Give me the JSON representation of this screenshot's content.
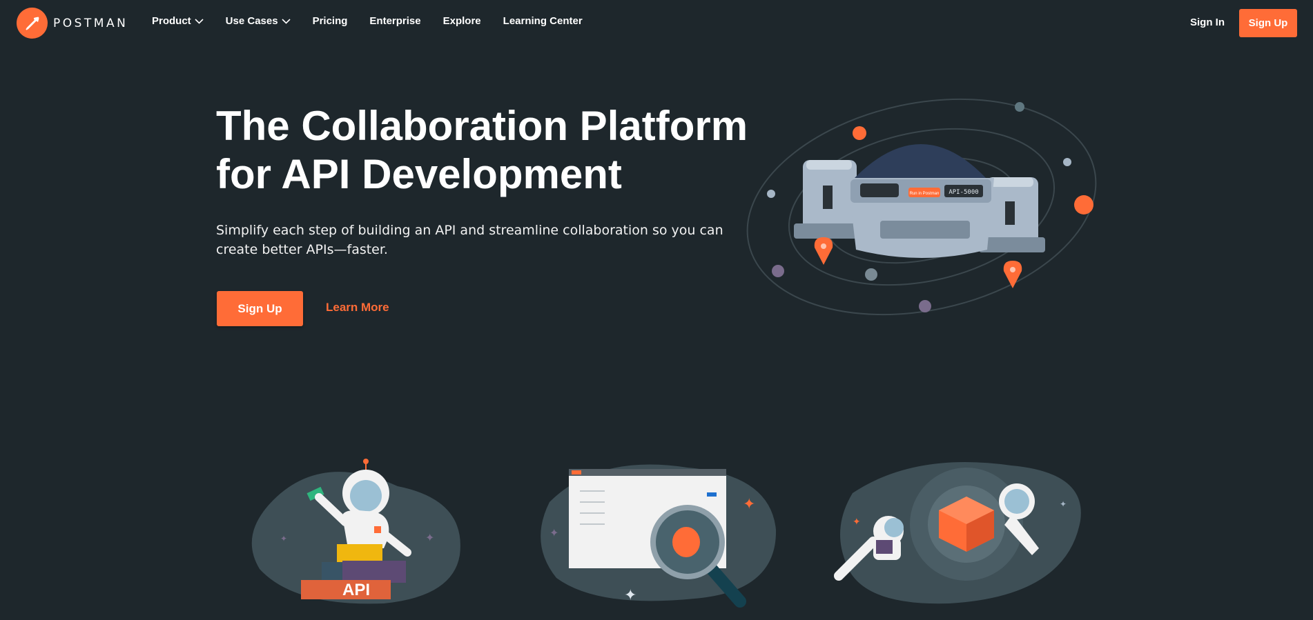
{
  "brand": {
    "name": "POSTMAN",
    "accent": "#ff6c37",
    "background": "#1e272c"
  },
  "nav": {
    "items": [
      {
        "label": "Product",
        "has_dropdown": true
      },
      {
        "label": "Use Cases",
        "has_dropdown": true
      },
      {
        "label": "Pricing"
      },
      {
        "label": "Enterprise"
      },
      {
        "label": "Explore"
      },
      {
        "label": "Learning Center"
      }
    ],
    "sign_in": "Sign In",
    "sign_up": "Sign Up"
  },
  "hero": {
    "title_line1": "The Collaboration Platform",
    "title_line2": "for API Development",
    "subtitle_line1": "Simplify each step of building an API and streamline collaboration so you can",
    "subtitle_line2": "create better APIs—faster.",
    "primary_cta": "Sign Up",
    "secondary_cta": "Learn More",
    "illustration": {
      "panel_label": "API-5000",
      "button_label": "Run in Postman"
    }
  },
  "features": {
    "api_block_label": "API"
  },
  "icons": {
    "logo": "postman-rocket-icon",
    "dropdown": "chevron-down-icon"
  }
}
